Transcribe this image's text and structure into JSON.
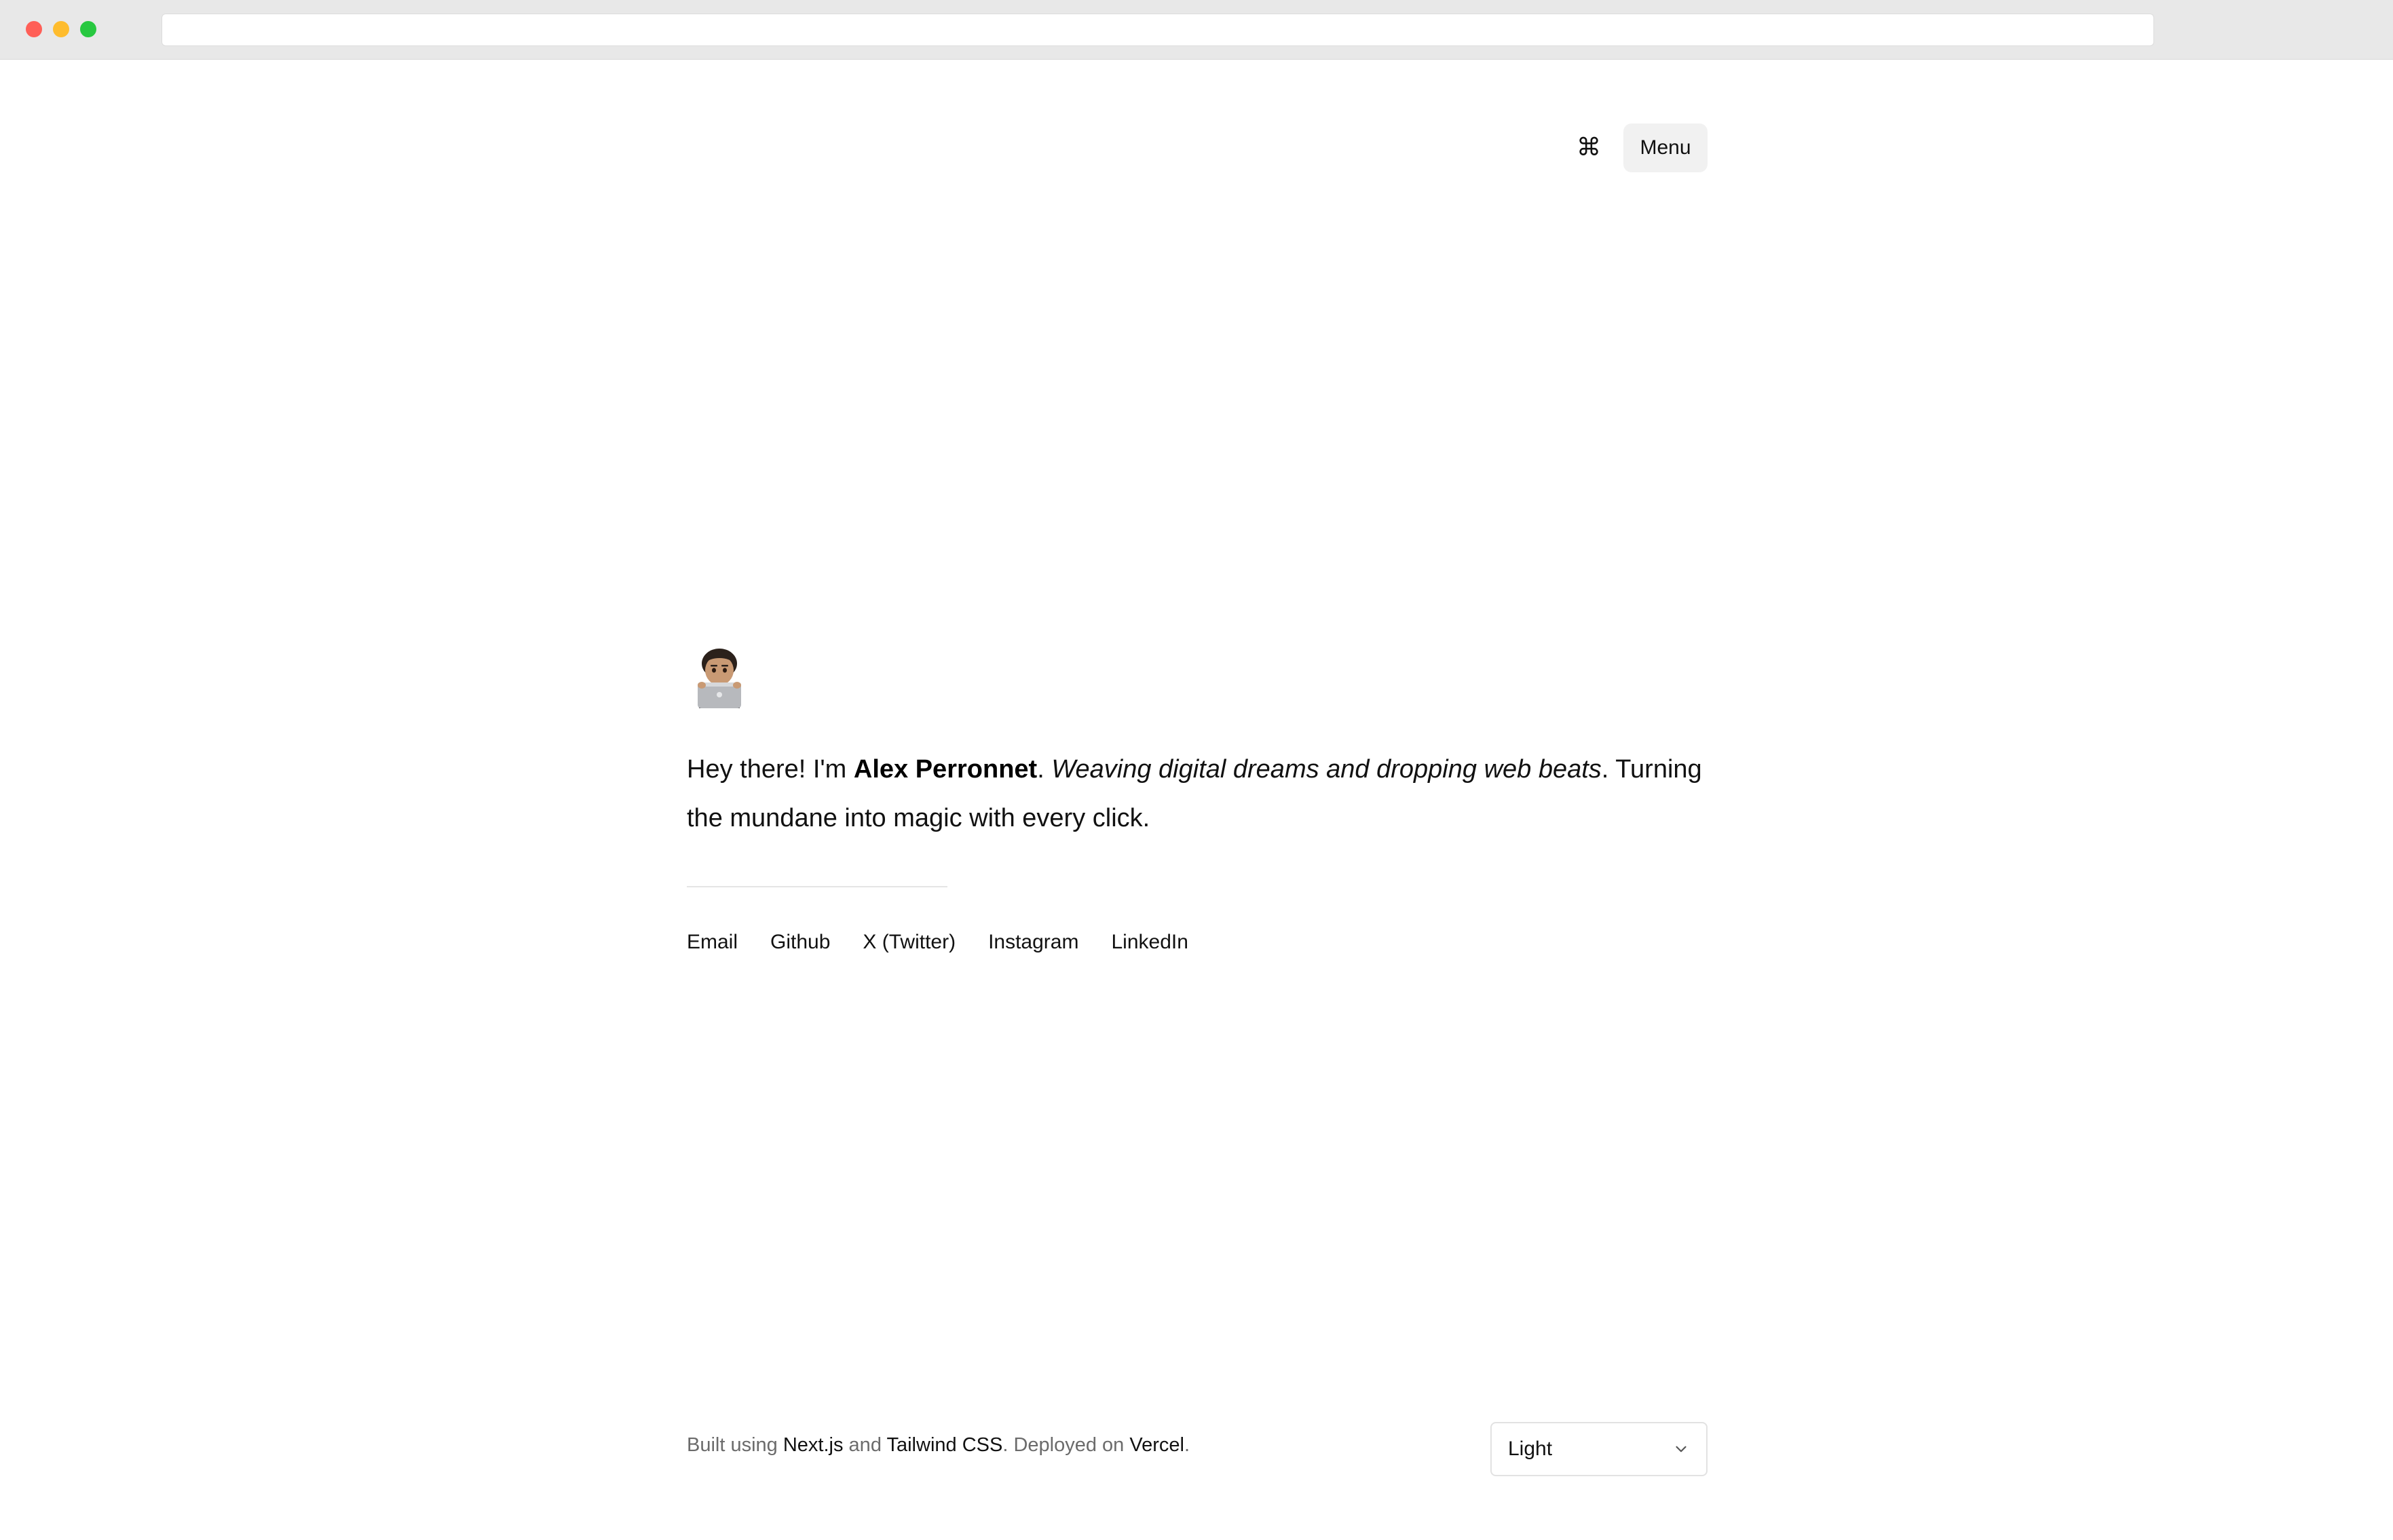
{
  "header": {
    "command_glyph": "⌘",
    "menu_label": "Menu"
  },
  "intro": {
    "greeting": "Hey there! I'm ",
    "name": "Alex Perronnet",
    "after_name": ". ",
    "tagline": "Weaving digital dreams and dropping web beats",
    "closing": ". Turning the mundane into magic with every click."
  },
  "social": [
    {
      "label": "Email"
    },
    {
      "label": "Github"
    },
    {
      "label": "X (Twitter)"
    },
    {
      "label": "Instagram"
    },
    {
      "label": "LinkedIn"
    }
  ],
  "footer": {
    "built_using": "Built using ",
    "nextjs": "Next.js",
    "and": " and ",
    "tailwind": "Tailwind CSS",
    "deployed_on": ". Deployed on ",
    "vercel": "Vercel",
    "period": "."
  },
  "theme_select": {
    "value": "Light"
  },
  "icons": {
    "avatar": "memoji-laptop-icon",
    "command": "command-icon",
    "chevron": "chevron-down-icon"
  }
}
